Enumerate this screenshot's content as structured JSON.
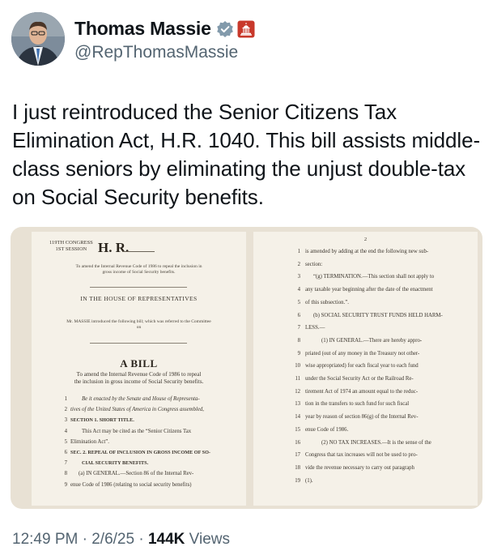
{
  "author": {
    "name": "Thomas Massie",
    "handle": "@RepThomasMassie",
    "verified_color": "#829aab",
    "gov_badge_color": "#c8392b"
  },
  "tweet": {
    "text": "I just reintroduced the Senior Citizens Tax Elimination Act, H.R. 1040. This bill assists middle-class seniors by eliminating the unjust double-tax on Social Security benefits."
  },
  "document": {
    "left": {
      "congress": "119TH CONGRESS",
      "session": "1ST SESSION",
      "bill_label": "H. R.",
      "summary_line1": "To amend the Internal Revenue Code of 1986 to repeal the inclusion in",
      "summary_line2": "gross income of Social Security benefits.",
      "house": "IN THE HOUSE OF REPRESENTATIVES",
      "intro": "Mr. MASSIE introduced the following bill; which was referred to the Committee",
      "intro_on": "on",
      "a_bill": "A BILL",
      "purpose_line1": "To amend the Internal Revenue Code of 1986 to repeal",
      "purpose_line2": "the inclusion in gross income of Social Security benefits.",
      "lines": [
        {
          "n": "1",
          "t": "Be it enacted by the Senate and House of Representa-"
        },
        {
          "n": "2",
          "t": "tives of the United States of America in Congress assembled,"
        },
        {
          "n": "3",
          "t": "SECTION 1. SHORT TITLE."
        },
        {
          "n": "4",
          "t": "This Act may be cited as the “Senior Citizens Tax"
        },
        {
          "n": "5",
          "t": "Elimination Act”."
        },
        {
          "n": "6",
          "t": "SEC. 2. REPEAL OF INCLUSION IN GROSS INCOME OF SO-"
        },
        {
          "n": "7",
          "t": "CIAL SECURITY BENEFITS."
        },
        {
          "n": "8",
          "t": "(a) IN GENERAL.—Section 86 of the Internal Rev-"
        },
        {
          "n": "9",
          "t": "enue Code of 1986 (relating to social security benefits)"
        }
      ]
    },
    "right": {
      "page_number": "2",
      "lines": [
        {
          "n": "1",
          "t": "is amended by adding at the end the following new sub-"
        },
        {
          "n": "2",
          "t": "section:"
        },
        {
          "n": "3",
          "t": "“(g) TERMINATION.—This section shall not apply to"
        },
        {
          "n": "4",
          "t": "any taxable year beginning after the date of the enactment"
        },
        {
          "n": "5",
          "t": "of this subsection.”."
        },
        {
          "n": "6",
          "t": "(b) SOCIAL SECURITY TRUST FUNDS HELD HARM-"
        },
        {
          "n": "7",
          "t": "LESS.—"
        },
        {
          "n": "8",
          "t": "(1) IN GENERAL.—There are hereby appro-"
        },
        {
          "n": "9",
          "t": "priated (out of any money in the Treasury not other-"
        },
        {
          "n": "10",
          "t": "wise appropriated) for each fiscal year to each fund"
        },
        {
          "n": "11",
          "t": "under the Social Security Act or the Railroad Re-"
        },
        {
          "n": "12",
          "t": "tirement Act of 1974 an amount equal to the reduc-"
        },
        {
          "n": "13",
          "t": "tion in the transfers to such fund for such fiscal"
        },
        {
          "n": "14",
          "t": "year by reason of section 86(g) of the Internal Rev-"
        },
        {
          "n": "15",
          "t": "enue Code of 1986."
        },
        {
          "n": "16",
          "t": "(2) NO TAX INCREASES.—It is the sense of the"
        },
        {
          "n": "17",
          "t": "Congress that tax increases will not be used to pro-"
        },
        {
          "n": "18",
          "t": "vide the revenue necessary to carry out paragraph"
        },
        {
          "n": "19",
          "t": "(1)."
        }
      ]
    }
  },
  "meta": {
    "time": "12:49 PM",
    "sep1": " · ",
    "date": "2/6/25",
    "sep2": " · ",
    "views_count": "144K",
    "views_label": " Views"
  }
}
